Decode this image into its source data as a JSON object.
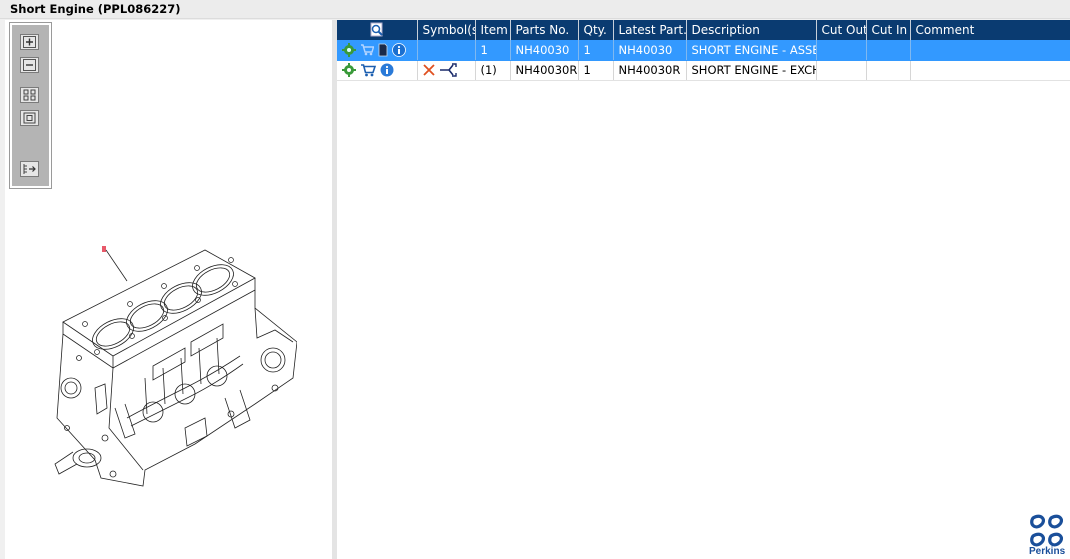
{
  "window": {
    "title": "Short Engine (PPL086227)"
  },
  "toolbox": {
    "buttons": [
      "zoom-in",
      "zoom-out",
      "fit-all",
      "fit-window",
      "exit-fullscreen"
    ]
  },
  "table": {
    "columns": [
      "",
      "Symbol(s)",
      "Item",
      "Parts No.",
      "Qty.",
      "Latest Part...",
      "Description",
      "Cut Out",
      "Cut In",
      "Comment"
    ],
    "rows": [
      {
        "item": "1",
        "part_no": "NH40030",
        "qty": "1",
        "latest_part": "NH40030",
        "description": "SHORT ENGINE - ASSEMBLY",
        "cut_out": "",
        "cut_in": "",
        "comment": "",
        "selected": true
      },
      {
        "item": "(1)",
        "part_no": "NH40030R",
        "qty": "1",
        "latest_part": "NH40030R",
        "description": "SHORT ENGINE - EXCHANGE",
        "cut_out": "",
        "cut_in": "",
        "comment": "",
        "selected": false
      }
    ]
  },
  "brand": {
    "name": "Perkins",
    "color": "#1a4f9a"
  },
  "colors": {
    "header": "#0a3b71",
    "selected": "#3399ff"
  }
}
